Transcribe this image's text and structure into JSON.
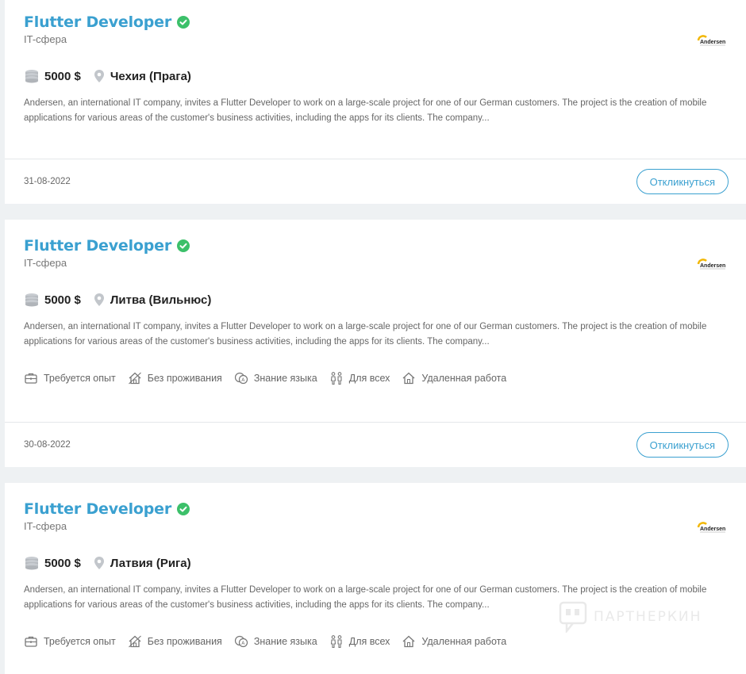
{
  "vacancies": [
    {
      "title": "Flutter Developer",
      "sphere": "IT-сфера",
      "salary": "5000 $",
      "location": "Чехия (Прага)",
      "description": "Andersen, an international IT company, invites a Flutter Developer to work on a large-scale project for one of our German customers. The project is the creation of mobile applications for various areas of the customer's business activities, including the apps for its clients. The company...",
      "tags": [],
      "date": "31-08-2022",
      "respond_label": "Откликнуться",
      "logo_text": "Andersen"
    },
    {
      "title": "Flutter Developer",
      "sphere": "IT-сфера",
      "salary": "5000 $",
      "location": "Литва (Вильнюс)",
      "description": "Andersen, an international IT company, invites a Flutter Developer to work on a large-scale project for one of our German customers. The project is the creation of mobile applications for various areas of the customer's business activities, including the apps for its clients. The company...",
      "tags": [
        "Требуется опыт",
        "Без проживания",
        "Знание языка",
        "Для всех",
        "Удаленная работа"
      ],
      "date": "30-08-2022",
      "respond_label": "Откликнуться",
      "logo_text": "Andersen"
    },
    {
      "title": "Flutter Developer",
      "sphere": "IT-сфера",
      "salary": "5000 $",
      "location": "Латвия (Рига)",
      "description": "Andersen, an international IT company, invites a Flutter Developer to work on a large-scale project for one of our German customers. The project is the creation of mobile applications for various areas of the customer's business activities, including the apps for its clients. The company...",
      "tags": [
        "Требуется опыт",
        "Без проживания",
        "Знание языка",
        "Для всех",
        "Удаленная работа"
      ],
      "date": "",
      "respond_label": "",
      "logo_text": "Andersen"
    }
  ],
  "tag_icons": [
    "briefcase-icon",
    "house-cross-icon",
    "language-bubbles-icon",
    "people-icon",
    "remote-home-icon"
  ],
  "watermark": "ПАРТНЕРКИН",
  "colors": {
    "accent": "#3aa0d0",
    "verified": "#3cc06a",
    "background": "#eef1f3"
  }
}
